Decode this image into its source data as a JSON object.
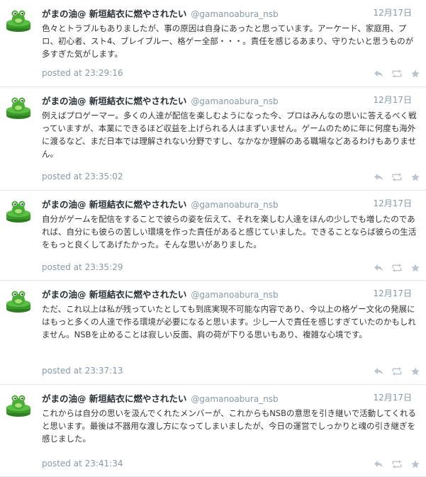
{
  "user": {
    "display_name": "がまの油@ 新垣結衣に燃やされたい",
    "handle": "@gamanoabura_nsb"
  },
  "icons": {
    "avatar": "frog-avatar-icon",
    "reply": "reply-icon",
    "retweet": "retweet-icon",
    "favorite": "star-icon"
  },
  "colors": {
    "meta": "#8899a6",
    "divider": "#e1e8ed",
    "frog": "#3a9a2a"
  },
  "tweets": [
    {
      "date": "12月17日",
      "text": "色々とトラブルもありましたが、事の原因は自身にあったと思っています。アーケード、家庭用、プロ、初心者、スト4、ブレイブルー、格ゲー全部・・・。責任を感じるあまり、守りたいと思うものが多すぎた気がします。",
      "posted": "posted at 23:29:16"
    },
    {
      "date": "12月17日",
      "text": "例えばプロゲーマー。多くの人達が配信を楽しむようになった今、プロはみんなの思いに答えるべく戦っていますが、本業にできるほど収益を上げられる人はまずいません。ゲームのために年に何度も海外に渡るなど、まだ日本では理解されない分野ですし、なかなか理解のある職場などあるわけもありません。",
      "posted": "posted at 23:35:02"
    },
    {
      "date": "12月17日",
      "text": "自分がゲームを配信をすることで彼らの姿を伝えて、それを楽しむ人達をほんの少しでも増したのであれば、自分にも彼らの苦しい環境を作った責任があると感じていました。できることならば彼らの生活をもっと良くしてあげたかった。そんな思いがありました。",
      "posted": "posted at 23:35:29"
    },
    {
      "date": "12月17日",
      "text": "ただ、これ以上は私が残っていたとしても到底実現不可能な内容であり、今以上の格ゲー文化の発展にはもっと多くの人達で作る環境が必要になると思います。少し一人で責任を感じすぎていたのかもしれません。NSBを止めることは寂しい反面、肩の荷が下りる思いもあり、複雑な心境です。",
      "posted": "posted at 23:37:13"
    },
    {
      "date": "12月17日",
      "text": "これからは自分の思いを汲んでくれたメンバーが、これからもNSBの意思を引き継いで活動してくれると思います。最後は不器用な渡し方になってしまいましたが、今日の運営でしっかりと魂の引き継ぎを感じました。",
      "posted": "posted at 23:41:34"
    }
  ]
}
